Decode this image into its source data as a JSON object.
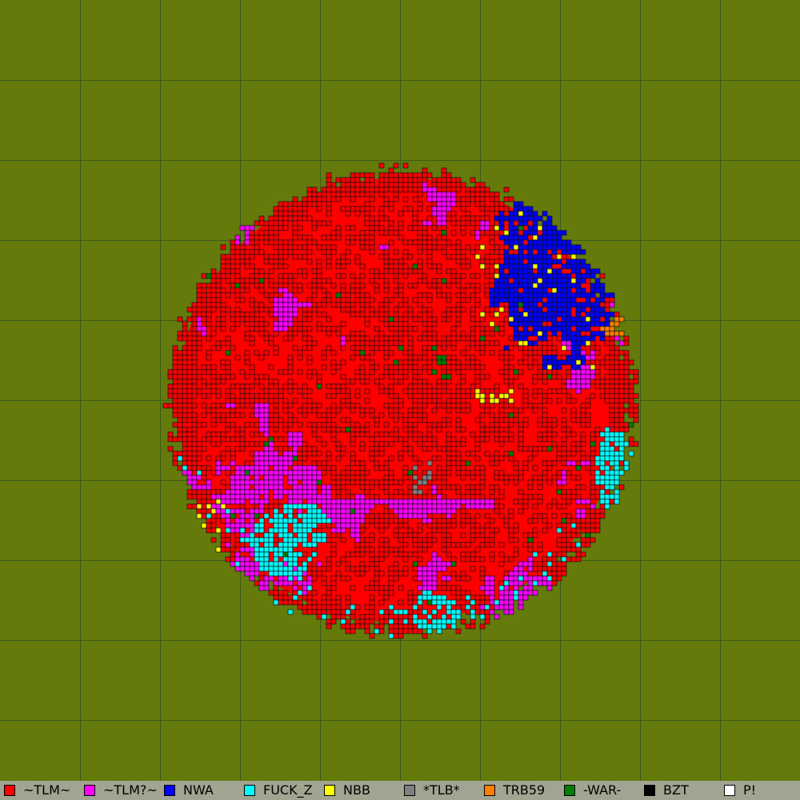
{
  "map": {
    "background_color": "#647b0c",
    "grid_color": "#3a5a1a",
    "cell_border_color": "#111111"
  },
  "legend": {
    "items": [
      {
        "label": "~TLM~",
        "color": "#ff0000"
      },
      {
        "label": "~TLM?~",
        "color": "#ff00ff"
      },
      {
        "label": "NWA",
        "color": "#0000ff"
      },
      {
        "label": "FUCK_Z",
        "color": "#00ffff"
      },
      {
        "label": "NBB",
        "color": "#ffff00"
      },
      {
        "label": "*TLB*",
        "color": "#808080"
      },
      {
        "label": "TRB59",
        "color": "#ff8000"
      },
      {
        "label": "-WAR-",
        "color": "#008000"
      },
      {
        "label": "BZT",
        "color": "#000000"
      },
      {
        "label": "P!",
        "color": "#ffffff"
      }
    ]
  }
}
